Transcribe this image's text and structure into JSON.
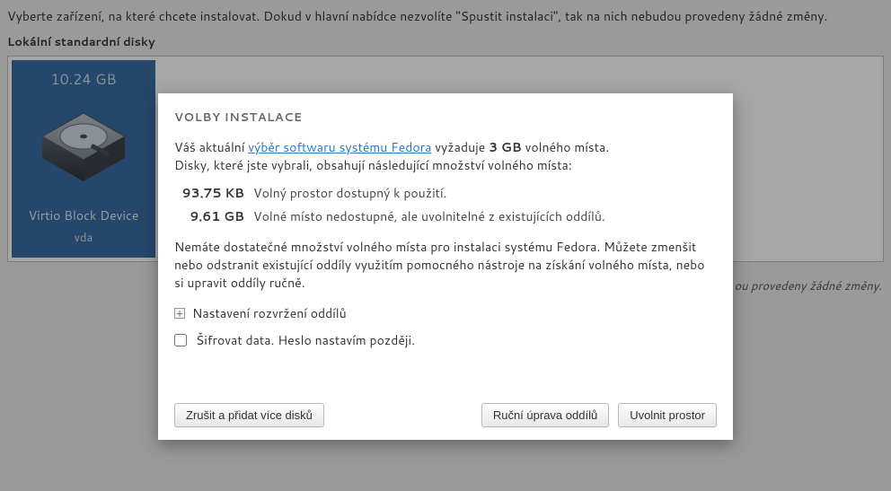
{
  "instructions": "Vyberte zařízení, na které chcete instalovat.  Dokud v hlavní nabídce nezvolíte \"Spustit instalaci\", tak na nich nebudou provedeny žádné změny.",
  "section_label": "Lokální standardní disky",
  "disk": {
    "size": "10.24 GB",
    "name": "Virtio Block Device",
    "id": "vda"
  },
  "hint_suffix": "ou provedeny žádné změny.",
  "modal": {
    "title": "VOLBY INSTALACE",
    "line1_pre": "Váš aktuální ",
    "line1_link": "výběr softwaru systému Fedora",
    "line1_mid": " vyžaduje ",
    "line1_req": "3 GB",
    "line1_post": " volného místa.",
    "line2": "Disky, které jste vybrali, obsahují následující množství volného místa:",
    "rows": [
      {
        "value": "93.75 KB",
        "label": "Volný prostor dostupný k použití."
      },
      {
        "value": "9.61 GB",
        "label": "Volné místo nedostupné, ale uvolnitelné z existujících oddílů."
      }
    ],
    "warn": "Nemáte dostatečné množství volného místa pro instalaci systému Fedora.  Můžete zmenšit nebo odstranit existující oddíly využitím pomocného nástroje na získání volného místa, nebo si upravit oddíly ručně.",
    "expander": "Nastavení rozvržení oddílů",
    "encrypt": "Šifrovat data. Heslo nastavím později.",
    "buttons": {
      "cancel": "Zrušit a přidat více disků",
      "manual": "Ruční úprava oddílů",
      "reclaim": "Uvolnit prostor"
    }
  }
}
